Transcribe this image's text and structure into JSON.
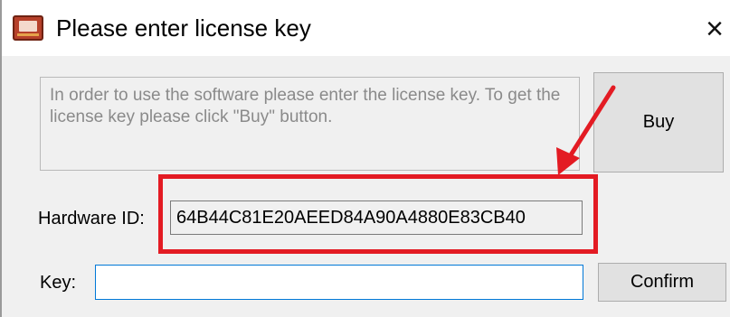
{
  "window": {
    "title": "Please enter license key",
    "close_glyph": "×"
  },
  "info": {
    "message": "In order to use the software please enter the license key. To get the license key please click  \"Buy\" button."
  },
  "buttons": {
    "buy_label": "Buy",
    "confirm_label": "Confirm"
  },
  "hardware": {
    "label": "Hardware ID:",
    "value": "64B44C81E20AEED84A90A4880E83CB40"
  },
  "key": {
    "label": "Key:",
    "value": ""
  },
  "colors": {
    "annotation_red": "#e31b23",
    "focus_border": "#0078d7"
  },
  "icons": {
    "app": "app-icon",
    "close": "close-icon",
    "annotation": "arrow-icon"
  }
}
